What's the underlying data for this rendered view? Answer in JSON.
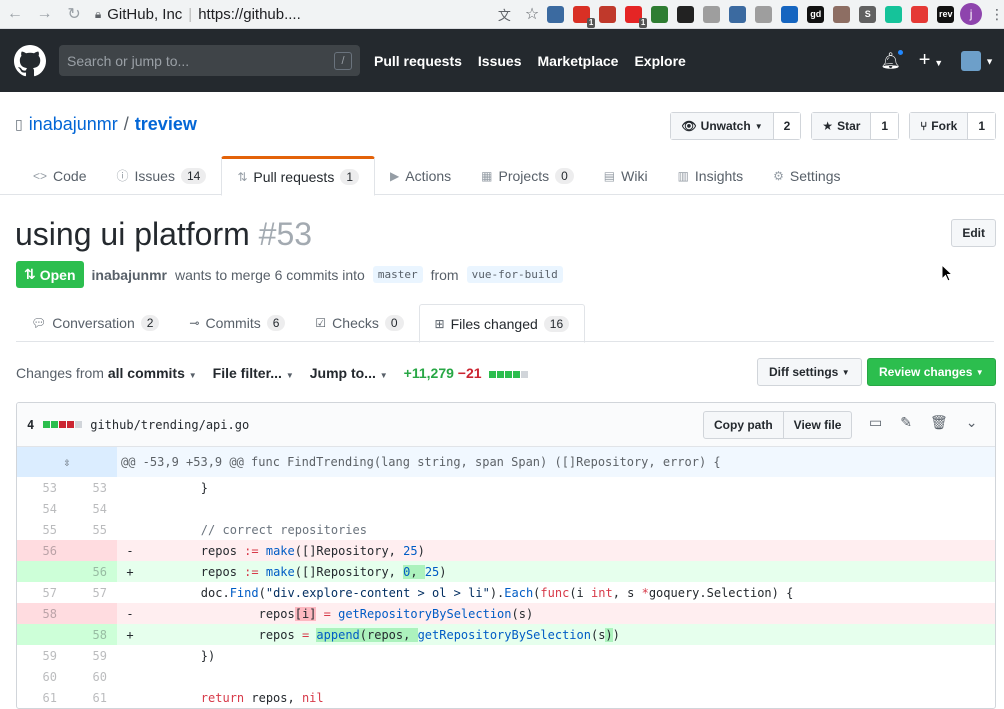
{
  "browser": {
    "site": "GitHub, Inc",
    "url": "https://github....",
    "profile_initial": "j",
    "extensions": [
      {
        "icon": "avatar-ext-icon",
        "color": "#3b6aa0",
        "badge": ""
      },
      {
        "icon": "todo-ext-icon",
        "color": "#d93025",
        "badge": "1"
      },
      {
        "icon": "book-ext-icon",
        "color": "#c0392b",
        "badge": ""
      },
      {
        "icon": "opera-ext-icon",
        "color": "#e52525",
        "badge": "1"
      },
      {
        "icon": "recycle-ext-icon",
        "color": "#2e7d32",
        "badge": ""
      },
      {
        "icon": "slash-ext-icon",
        "color": "#222222",
        "badge": ""
      },
      {
        "icon": "grid-ext-icon",
        "color": "#9e9e9e",
        "badge": ""
      },
      {
        "icon": "avatar2-ext-icon",
        "color": "#3b6aa0",
        "badge": ""
      },
      {
        "icon": "vuetify-ext-icon",
        "color": "#9e9e9e",
        "badge": ""
      },
      {
        "icon": "bars-ext-icon",
        "color": "#1565c0",
        "badge": ""
      },
      {
        "icon": "gd-ext-icon",
        "color": "#111111",
        "badge": ""
      },
      {
        "icon": "photo-ext-icon",
        "color": "#8d6e63",
        "badge": ""
      },
      {
        "icon": "s-ext-icon",
        "color": "#616161",
        "badge": ""
      },
      {
        "icon": "grammarly-ext-icon",
        "color": "#15c39a",
        "badge": ""
      },
      {
        "icon": "pen-ext-icon",
        "color": "#e53935",
        "badge": ""
      },
      {
        "icon": "rev-ext-icon",
        "color": "#111111",
        "badge": ""
      }
    ],
    "ext_labels": {
      "gd": "gd",
      "s": "S",
      "rev": "rev"
    }
  },
  "header": {
    "search_placeholder": "Search or jump to...",
    "slash_key": "/",
    "nav": [
      "Pull requests",
      "Issues",
      "Marketplace",
      "Explore"
    ],
    "plus": "+"
  },
  "repo": {
    "owner": "inabajunmr",
    "separator": "/",
    "name": "treview",
    "watch_label": "Unwatch",
    "watch_count": "2",
    "star_label": "Star",
    "star_count": "1",
    "fork_label": "Fork",
    "fork_count": "1",
    "tabs": [
      {
        "label": "Code",
        "count": null
      },
      {
        "label": "Issues",
        "count": "14"
      },
      {
        "label": "Pull requests",
        "count": "1"
      },
      {
        "label": "Actions",
        "count": null
      },
      {
        "label": "Projects",
        "count": "0"
      },
      {
        "label": "Wiki",
        "count": null
      },
      {
        "label": "Insights",
        "count": null
      },
      {
        "label": "Settings",
        "count": null
      }
    ]
  },
  "pr": {
    "title": "using ui platform",
    "number": "#53",
    "edit_label": "Edit",
    "state": "Open",
    "author": "inabajunmr",
    "meta_text": "wants to merge 6 commits into",
    "base_branch": "master",
    "from_text": "from",
    "head_branch": "vue-for-build",
    "tabs": [
      {
        "label": "Conversation",
        "count": "2"
      },
      {
        "label": "Commits",
        "count": "6"
      },
      {
        "label": "Checks",
        "count": "0"
      },
      {
        "label": "Files changed",
        "count": "16"
      }
    ]
  },
  "toolbar": {
    "changes_prefix": "Changes from",
    "changes_value": "all commits",
    "file_filter": "File filter...",
    "jump_to": "Jump to...",
    "additions": "+11,279",
    "deletions": "−21",
    "diff_settings": "Diff settings",
    "review_changes": "Review changes"
  },
  "file": {
    "change_count": "4",
    "path": "github/trending/api.go",
    "copy_path": "Copy path",
    "view_file": "View file",
    "hunk_header": "@@ -53,9 +53,9 @@ func FindTrending(lang string, span Span) ([]Repository, error) {"
  },
  "colors": {
    "accent_tab": "#e36209",
    "open_green": "#2cbe4e",
    "link_blue": "#0366d6",
    "header_bg": "#24292e"
  }
}
